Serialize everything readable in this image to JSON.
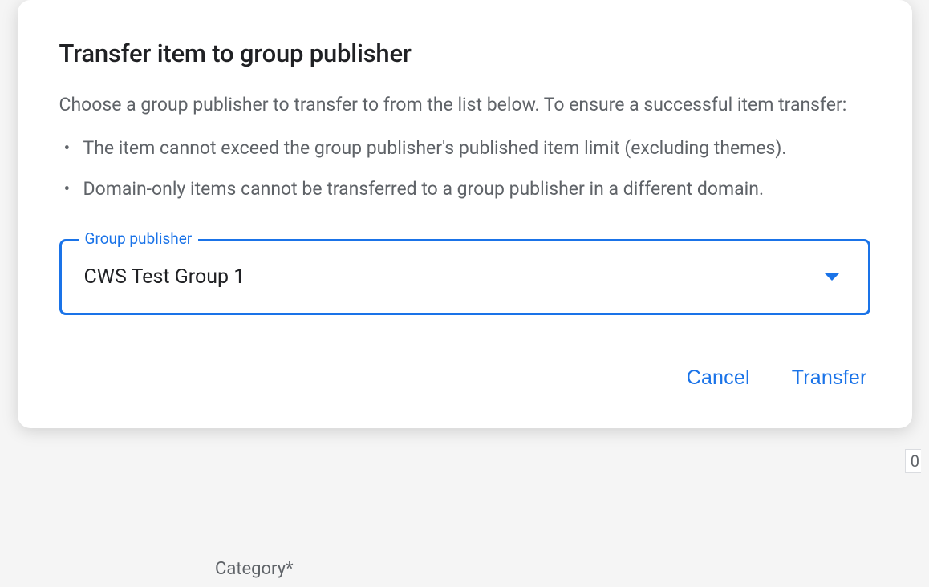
{
  "modal": {
    "title": "Transfer item to group publisher",
    "description": "Choose a group publisher to transfer to from the list below. To ensure a successful item transfer:",
    "listItems": [
      "The item cannot exceed the group publisher's published item limit (excluding themes).",
      "Domain-only items cannot be transferred to a group publisher in a different domain."
    ],
    "select": {
      "label": "Group publisher",
      "value": "CWS Test Group 1"
    },
    "actions": {
      "cancel": "Cancel",
      "transfer": "Transfer"
    }
  },
  "background": {
    "categoryLabel": "Category*",
    "fieldValue": "0"
  }
}
